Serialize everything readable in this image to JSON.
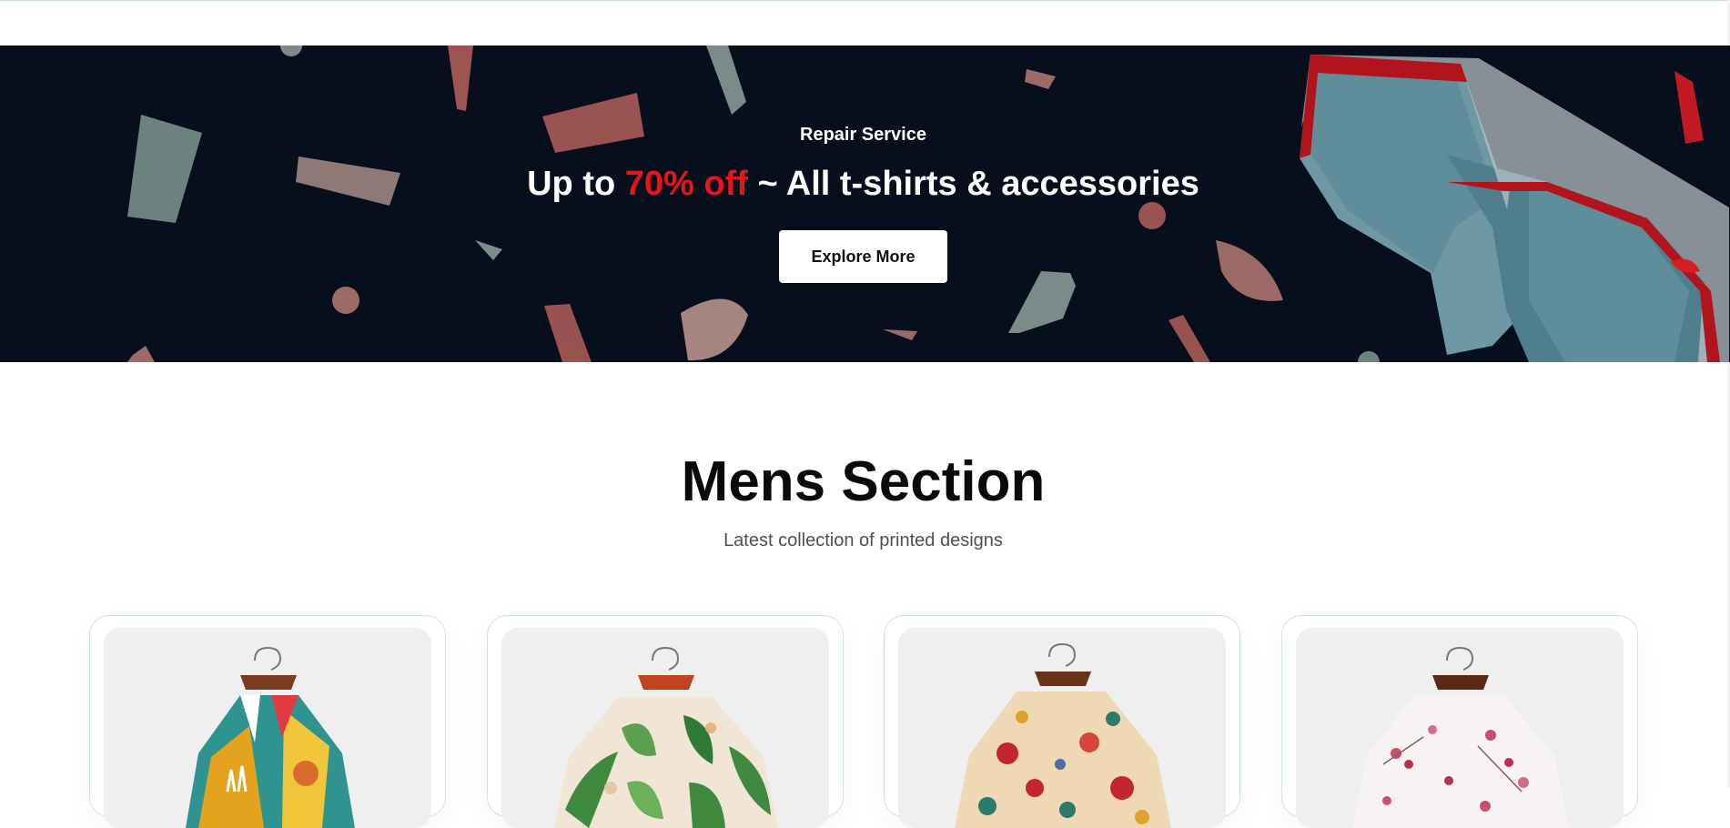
{
  "banner": {
    "eyebrow": "Repair Service",
    "headline_prefix": "Up to",
    "headline_accent": "70% off",
    "headline_suffix": "~ All t-shirts & accessories",
    "cta_label": "Explore More",
    "background_color": "#070e1c",
    "accent_color": "#e8141b"
  },
  "mens_section": {
    "title": "Mens Section",
    "subtitle": "Latest collection of printed designs",
    "products": [
      {
        "image": "printed-shirt-multicolor-abstract"
      },
      {
        "image": "printed-shirt-green-floral"
      },
      {
        "image": "printed-shirt-red-rose-floral"
      },
      {
        "image": "printed-shirt-white-pink-blossom"
      }
    ]
  }
}
